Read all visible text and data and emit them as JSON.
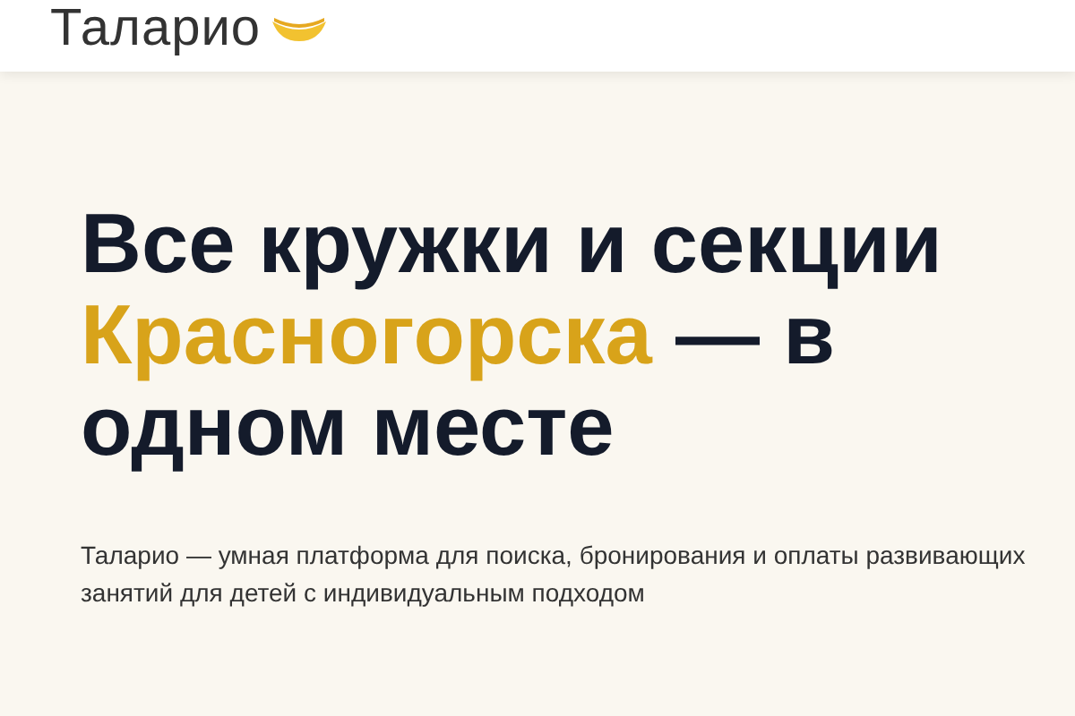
{
  "header": {
    "logo": "Таларио"
  },
  "hero": {
    "title_parts": [
      {
        "text": "Все кружки и секции ",
        "highlight": false
      },
      {
        "text": "Красногорска",
        "highlight": true
      },
      {
        "text": " — в одном месте",
        "highlight": false
      }
    ],
    "subtitle": "Таларио — умная платформа для поиска, бронирования и оплаты развивающих занятий для детей с индивидуальным подходом"
  }
}
